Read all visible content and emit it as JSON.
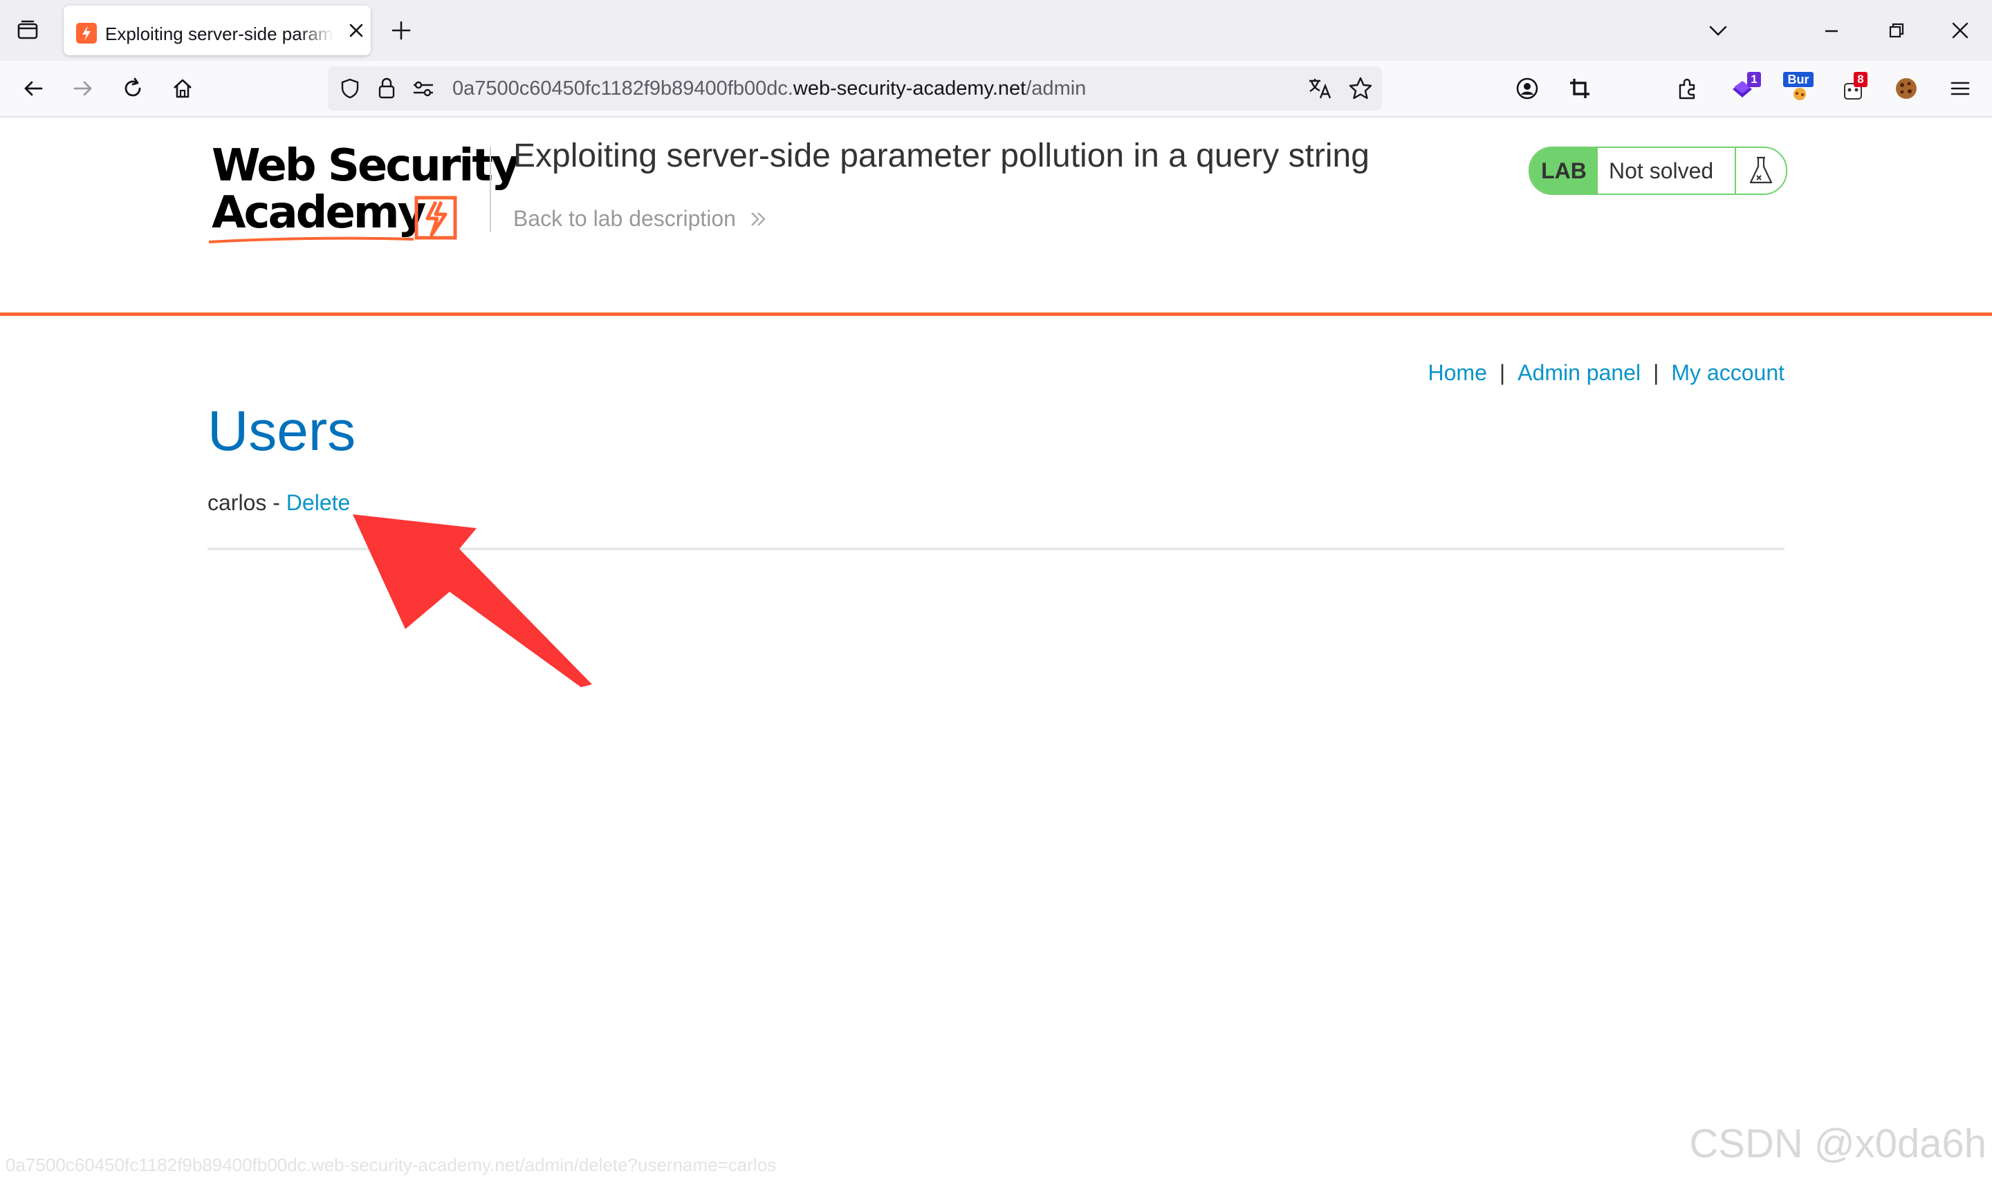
{
  "browser": {
    "tab": {
      "title": "Exploiting server-side parameter pollution in a query string"
    },
    "url": {
      "subdomain": "0a7500c60450fc1182f9b89400fb00dc.",
      "domain": "web-security-academy.net",
      "path": "/admin"
    },
    "extensions": {
      "badge_one": "1",
      "badge_bur": "Bur",
      "badge_eight": "8"
    },
    "status_url": "0a7500c60450fc1182f9b89400fb00dc.web-security-academy.net/admin/delete?username=carlos"
  },
  "header": {
    "logo_line1": "Web Security",
    "logo_line2": "Academy",
    "lab_title": "Exploiting server-side parameter pollution in a query string",
    "back_link": "Back to lab description",
    "lab_badge": {
      "label": "LAB",
      "status": "Not solved"
    }
  },
  "nav": {
    "home": "Home",
    "admin_panel": "Admin panel",
    "my_account": "My account",
    "separator": "|"
  },
  "main": {
    "heading": "Users",
    "users": [
      {
        "name": "carlos",
        "separator": " - ",
        "action": "Delete"
      }
    ]
  },
  "watermark": "CSDN @x0da6h",
  "colors": {
    "accent_orange": "#ff6633",
    "lab_green": "#70d16d",
    "link_blue": "#0a94c9",
    "heading_blue": "#0071bc",
    "annotation_red": "#fc3535"
  }
}
